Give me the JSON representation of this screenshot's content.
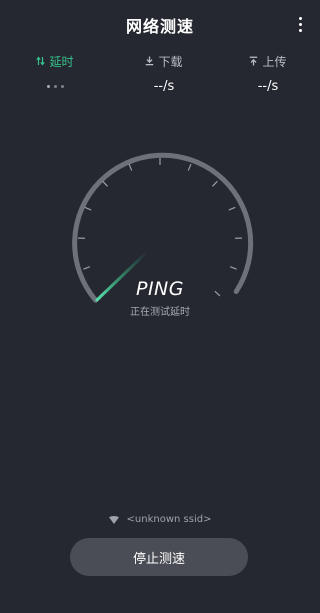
{
  "header": {
    "title": "网络测速",
    "menu_icon": "more-vertical-icon"
  },
  "metrics": [
    {
      "label": "延时",
      "icon": "swap-vertical-icon",
      "value": "",
      "state": "active",
      "loading": true
    },
    {
      "label": "下载",
      "icon": "download-icon",
      "value": "--/s"
    },
    {
      "label": "上传",
      "icon": "upload-icon",
      "value": "--/s"
    }
  ],
  "gauge": {
    "mode": "PING",
    "status": "正在测试延时"
  },
  "network": {
    "icon": "wifi-icon",
    "ssid": "<unknown ssid>"
  },
  "actions": {
    "stop_label": "停止测速"
  },
  "colors": {
    "background": "#252830",
    "accent": "#35c28b",
    "gauge_track": "#6e7178",
    "button": "#4a4d55"
  }
}
